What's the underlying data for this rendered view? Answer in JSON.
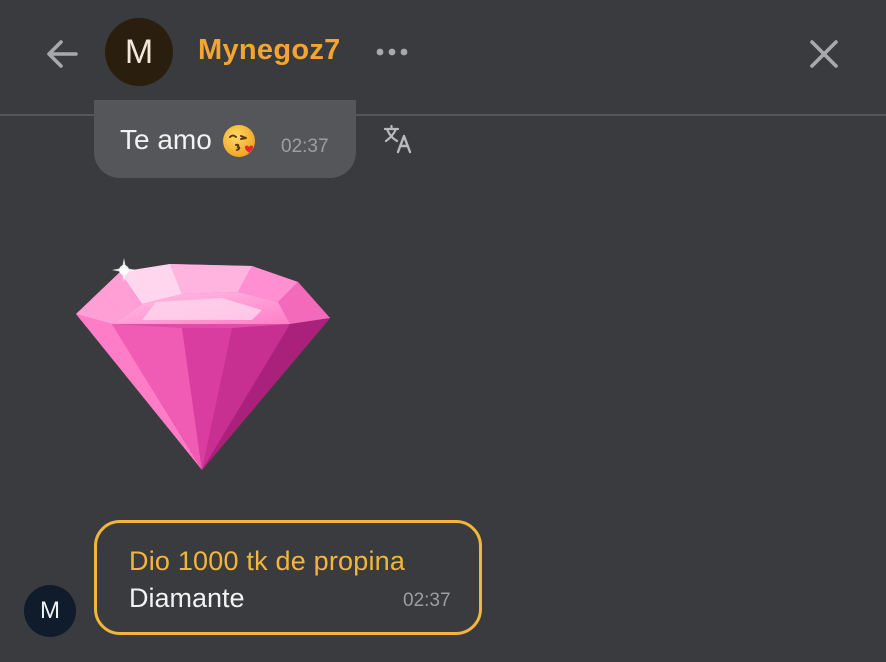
{
  "header": {
    "avatar_letter": "M",
    "username": "Mynegoz7",
    "username_color": "#f4a531"
  },
  "messages": [
    {
      "text": "Te amo",
      "emoji": "kissing-face-with-heart-emoji",
      "time": "02:37"
    }
  ],
  "gift": {
    "sender_avatar_letter": "M",
    "title": "Dio 1000 tk de propina",
    "name": "Diamante",
    "time": "02:37",
    "accent_color": "#f2b63a",
    "image": "pink-diamond"
  },
  "icons": {
    "back": "back-arrow-icon",
    "more": "more-dots-icon",
    "close": "close-icon",
    "translate": "translate-icon"
  },
  "colors": {
    "background": "#3a3b3f",
    "bubble": "#55565a"
  }
}
